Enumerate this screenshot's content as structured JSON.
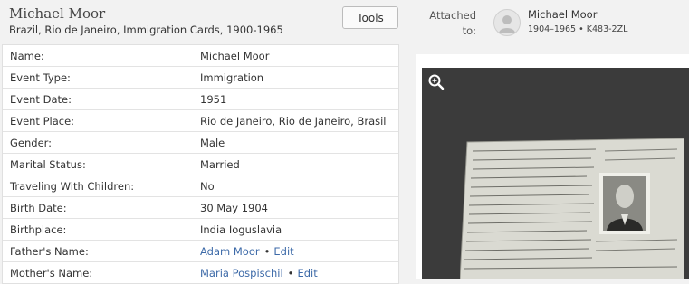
{
  "header": {
    "name": "Michael Moor",
    "collection": "Brazil, Rio de Janeiro, Immigration Cards, 1900-1965"
  },
  "toolbar": {
    "tools_label": "Tools"
  },
  "attached": {
    "label": "Attached to:",
    "person_name": "Michael Moor",
    "person_meta": "1904–1965 • K483-2ZL"
  },
  "record": {
    "rows": [
      {
        "label": "Name:",
        "value": "Michael Moor"
      },
      {
        "label": "Event Type:",
        "value": "Immigration"
      },
      {
        "label": "Event Date:",
        "value": "1951"
      },
      {
        "label": "Event Place:",
        "value": "Rio de Janeiro, Rio de Janeiro, Brasil"
      },
      {
        "label": "Gender:",
        "value": "Male"
      },
      {
        "label": "Marital Status:",
        "value": "Married"
      },
      {
        "label": "Traveling With Children:",
        "value": "No"
      },
      {
        "label": "Birth Date:",
        "value": "30 May 1904"
      },
      {
        "label": "Birthplace:",
        "value": "India Ioguslavia"
      },
      {
        "label": "Father's Name:",
        "value": "Adam Moor",
        "action": "Edit"
      },
      {
        "label": "Mother's Name:",
        "value": "Maria Pospischil",
        "action": "Edit"
      }
    ]
  },
  "viewer": {
    "zoom_icon": "zoom-in-icon"
  },
  "colors": {
    "link": "#3d6aa8",
    "viewer_bg": "#3b3b3b",
    "background": "#f2f2f2"
  }
}
